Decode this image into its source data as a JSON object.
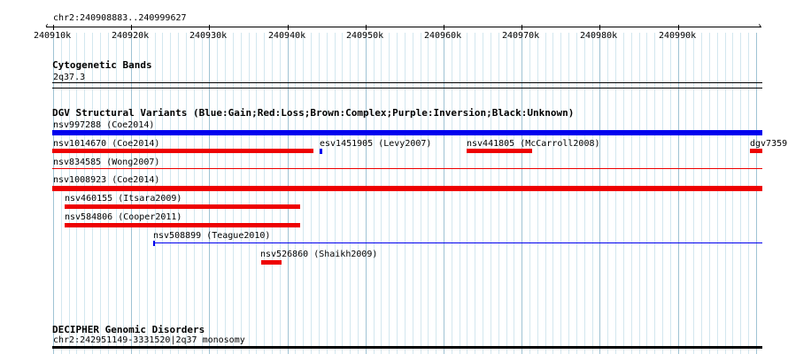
{
  "ruler": {
    "locus": "chr2:240908883..240999627",
    "ticks": [
      "240910k",
      "240920k",
      "240930k",
      "240940k",
      "240950k",
      "240960k",
      "240970k",
      "240980k",
      "240990k"
    ]
  },
  "tracks": {
    "cytoband": {
      "title": "Cytogenetic Bands",
      "band": "2q37.3"
    },
    "dgv": {
      "title": "DGV Structural Variants (Blue:Gain;Red:Loss;Brown:Complex;Purple:Inversion;Black:Unknown)",
      "features": [
        {
          "label": "nsv997288 (Coe2014)",
          "type": "gain"
        },
        {
          "label": "nsv1014670 (Coe2014)",
          "type": "loss"
        },
        {
          "label": "esv1451905 (Levy2007)",
          "type": "gain"
        },
        {
          "label": "nsv441805 (McCarroll2008)",
          "type": "loss"
        },
        {
          "label": "dgv7359n",
          "type": "loss"
        },
        {
          "label": "nsv834585 (Wong2007)",
          "type": "loss"
        },
        {
          "label": "nsv1008923 (Coe2014)",
          "type": "loss"
        },
        {
          "label": "nsv460155 (Itsara2009)",
          "type": "loss"
        },
        {
          "label": "nsv584806 (Cooper2011)",
          "type": "loss"
        },
        {
          "label": "nsv508899 (Teague2010)",
          "type": "gain"
        },
        {
          "label": "nsv526860 (Shaikh2009)",
          "type": "loss"
        }
      ]
    },
    "decipher": {
      "title": "DECIPHER Genomic Disorders",
      "feature": "chr2:242951149-3331520|2q37 monosomy"
    }
  },
  "colors": {
    "gain": "#0000ee",
    "loss": "#ee0000",
    "grid_major": "#9fc3d4",
    "grid_minor": "#d3e7ef"
  }
}
